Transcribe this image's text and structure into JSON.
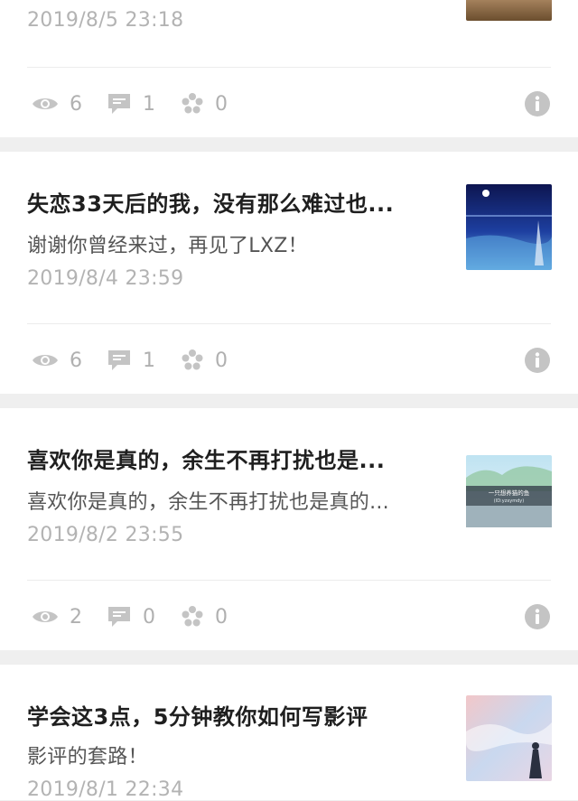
{
  "posts": [
    {
      "title": "",
      "subtitle": "",
      "date": "2019/8/5 23:18",
      "views": "6",
      "comments": "1",
      "likes": "0",
      "thumb_icon": "thumbnail-image"
    },
    {
      "title": "失恋33天后的我，没有那么难过也...",
      "subtitle": "谢谢你曾经来过，再见了LXZ！",
      "date": "2019/8/4 23:59",
      "views": "6",
      "comments": "1",
      "likes": "0",
      "thumb_icon": "night-sea-image"
    },
    {
      "title": "喜欢你是真的，余生不再打扰也是...",
      "subtitle": "喜欢你是真的，余生不再打扰也是真的...",
      "date": "2019/8/2 23:55",
      "views": "2",
      "comments": "0",
      "likes": "0",
      "thumb_icon": "anime-street-image",
      "thumb_caption": "一只想养猫的鱼",
      "thumb_caption2": "(ID:yzxymdy)"
    },
    {
      "title": "学会这3点，5分钟教你如何写影评",
      "subtitle": "影评的套路！",
      "date": "2019/8/1 22:34",
      "thumb_icon": "anime-sky-image"
    }
  ],
  "colors": {
    "background": "#efefef",
    "card": "#ffffff",
    "title": "#1f1f1f",
    "meta": "#b3b3b3",
    "icon": "#c4c4c4"
  }
}
